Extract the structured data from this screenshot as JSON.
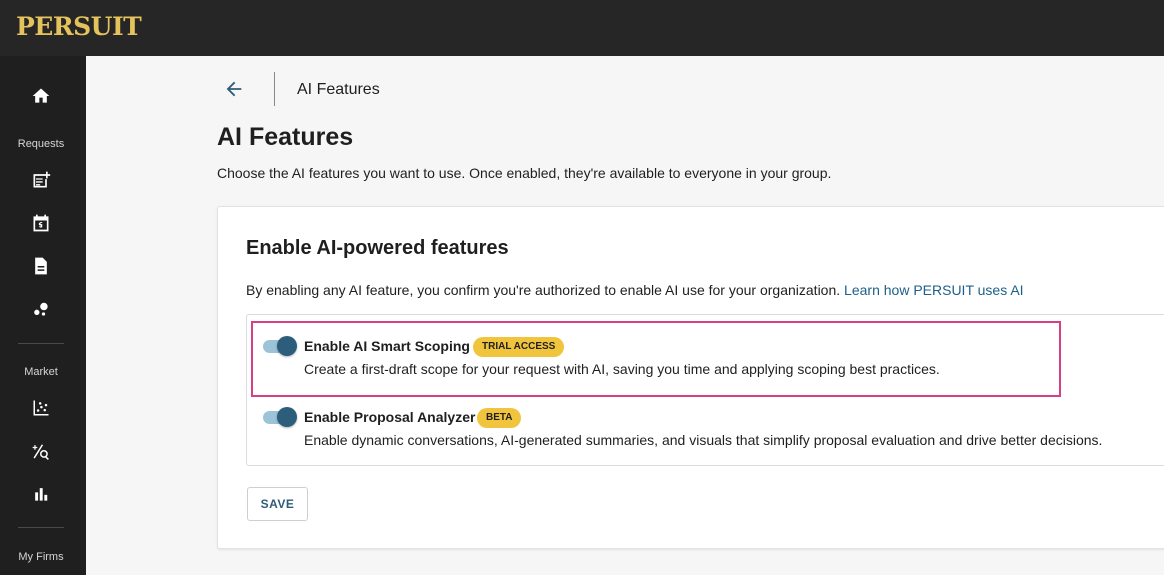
{
  "brand": {
    "logo_text": "PERSUIT",
    "color": "#e4c25c"
  },
  "sidebar": {
    "sections": [
      {
        "label": "Requests"
      },
      {
        "label": "Market"
      },
      {
        "label": "My Firms"
      }
    ],
    "icons": [
      "home-icon",
      "new-request-icon",
      "calendar-dollar-icon",
      "document-icon",
      "bubbles-icon",
      "scatter-chart-icon",
      "rate-search-icon",
      "bar-chart-icon"
    ]
  },
  "breadcrumb": {
    "back_icon": "arrow-left-icon",
    "current": "AI Features"
  },
  "page": {
    "title": "AI Features",
    "description": "Choose the AI features you want to use. Once enabled, they're available to everyone in your group."
  },
  "card": {
    "title": "Enable AI-powered features",
    "description": "By enabling any AI feature, you confirm you're authorized to enable AI use for your organization.",
    "learn_link": "Learn how PERSUIT uses AI",
    "features": [
      {
        "name": "Enable AI Smart Scoping",
        "badge": "TRIAL ACCESS",
        "enabled": true,
        "description": "Create a first-draft scope for your request with AI, saving you time and applying scoping best practices."
      },
      {
        "name": "Enable Proposal Analyzer",
        "badge": "BETA",
        "enabled": true,
        "description": "Enable dynamic conversations, AI-generated summaries, and visuals that simplify proposal evaluation and drive better decisions."
      }
    ],
    "save_label": "SAVE"
  },
  "colors": {
    "accent": "#2c5d7a",
    "badge": "#f0c43c",
    "highlight": "#d63e86",
    "link": "#1d5f8a"
  }
}
